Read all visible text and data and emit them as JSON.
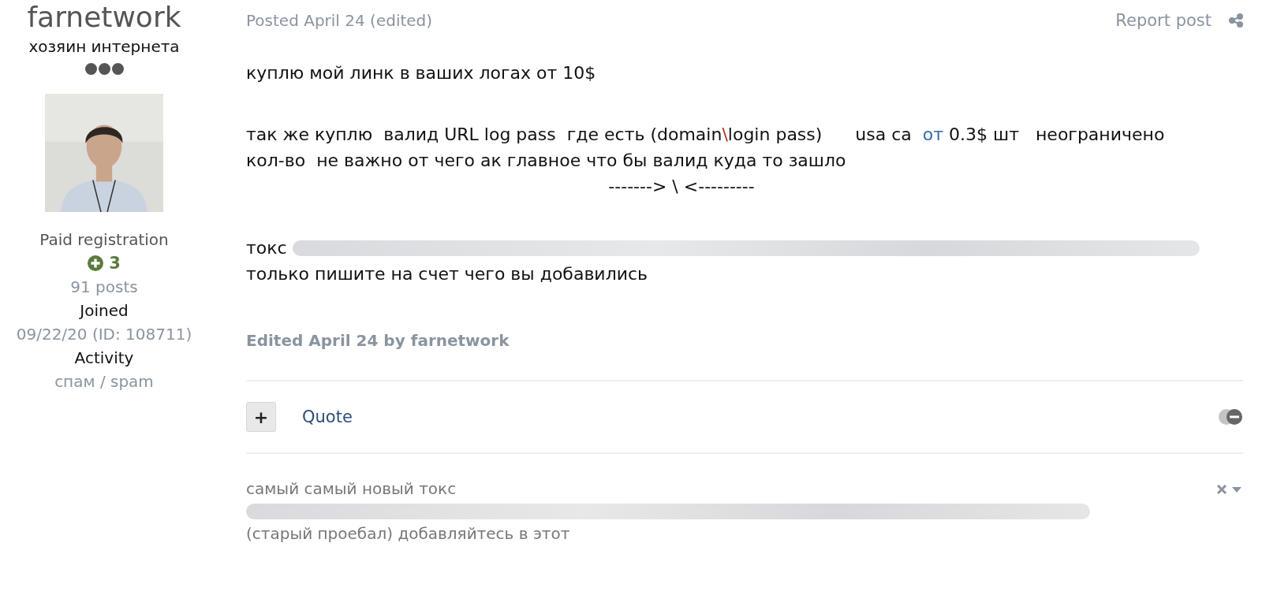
{
  "author": {
    "name": "farnetwork",
    "title": "хозяин интернета",
    "group": "Paid registration",
    "reputation": "3",
    "posts": "91 posts",
    "joined_label": "Joined",
    "joined_value": "09/22/20 (ID: 108711)",
    "activity_label": "Activity",
    "activity_value": "спам / spam"
  },
  "post": {
    "posted": "Posted April 24 (edited)",
    "report": "Report post",
    "paragraphs": [
      [
        {
          "kind": "text",
          "segments": [
            {
              "kind": "plain",
              "text": "куплю мой линк в ваших логах от 10$"
            }
          ]
        }
      ],
      [
        {
          "kind": "text",
          "segments": [
            {
              "kind": "plain",
              "text": "так же куплю  валид URL log pass  где есть (domain"
            },
            {
              "kind": "accent",
              "text": "\\"
            },
            {
              "kind": "plain",
              "text": "login pass)      usa ca  "
            },
            {
              "kind": "link",
              "text": "от"
            },
            {
              "kind": "plain",
              "text": " 0.3$ шт   неограничено"
            }
          ]
        },
        {
          "kind": "text",
          "segments": [
            {
              "kind": "plain",
              "text": "кол-во  не важно от чего ак главное что бы валид куда то зашло"
            }
          ]
        },
        {
          "kind": "centered",
          "segments": [
            {
              "kind": "plain",
              "text": "-------> \\ <---------"
            }
          ]
        }
      ],
      [
        {
          "kind": "text",
          "segments": [
            {
              "kind": "plain",
              "text": "токс "
            },
            {
              "kind": "blurred"
            }
          ]
        },
        {
          "kind": "text",
          "segments": [
            {
              "kind": "plain",
              "text": "только пишите на счет чего вы добавились"
            }
          ]
        }
      ]
    ],
    "edited": "Edited April 24 by farnetwork",
    "plus": "+",
    "quote": "Quote"
  },
  "signature": {
    "lines": [
      {
        "segments": [
          {
            "kind": "plain",
            "text": "самый самый новый токс"
          }
        ]
      },
      {
        "segments": [
          {
            "kind": "blurred"
          }
        ]
      },
      {
        "segments": [
          {
            "kind": "plain",
            "text": "(старый проебал) добавляйтесь в этот"
          }
        ]
      }
    ]
  }
}
